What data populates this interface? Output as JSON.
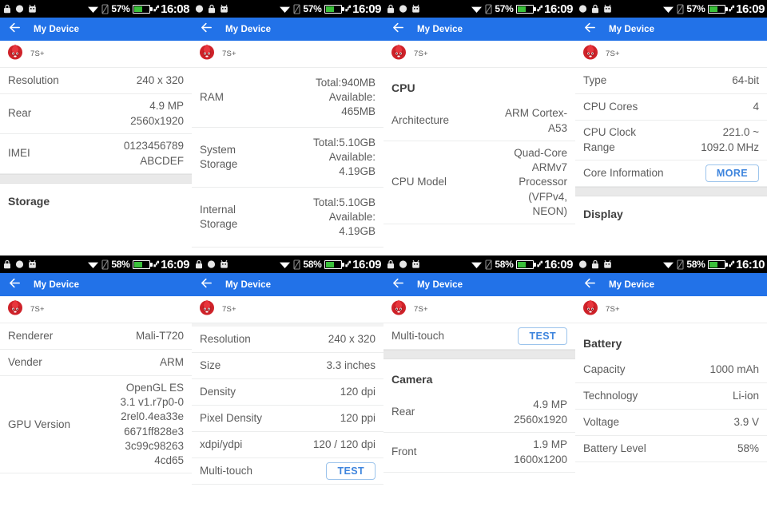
{
  "app": {
    "title": "My Device",
    "device_name": "7S+",
    "accent_color": "#2272e8",
    "logo_icon": "antutu-flame-logo",
    "back_icon": "back-arrow-icon"
  },
  "panels": [
    {
      "status": {
        "time": "16:08",
        "battery_percent": "57%",
        "left_icons": [
          "lock-icon",
          "circle-icon",
          "android-robot-icon"
        ],
        "right_icons": [
          "wifi-icon",
          "sim-card-off-icon",
          "battery-charging-icon"
        ]
      },
      "rows": [
        {
          "key": "Resolution",
          "value": "240 x 320",
          "size": "one"
        },
        {
          "key": "Rear",
          "value": "4.9 MP\n2560x1920",
          "size": "two"
        },
        {
          "key": "IMEI",
          "value": "0123456789\nABCDEF",
          "size": "two"
        }
      ],
      "band_after_rows": true,
      "section_footer": "Storage"
    },
    {
      "status": {
        "time": "16:09",
        "battery_percent": "57%",
        "left_icons": [
          "circle-icon",
          "lock-icon",
          "android-robot-icon"
        ],
        "right_icons": [
          "wifi-icon",
          "sim-card-off-icon",
          "battery-charging-icon"
        ]
      },
      "rows": [
        {
          "key": "RAM",
          "value": "Total:940MB\nAvailable:\n465MB",
          "size": "three"
        },
        {
          "key": "System\nStorage",
          "value": "Total:5.10GB\nAvailable:\n4.19GB",
          "size": "three"
        },
        {
          "key": "Internal\nStorage",
          "value": "Total:5.10GB\nAvailable:\n4.19GB",
          "size": "three"
        }
      ]
    },
    {
      "status": {
        "time": "16:09",
        "battery_percent": "57%",
        "left_icons": [
          "lock-icon",
          "circle-icon",
          "android-robot-icon"
        ],
        "right_icons": [
          "wifi-icon",
          "sim-card-off-icon",
          "battery-charging-icon"
        ]
      },
      "section_header": "CPU",
      "rows": [
        {
          "key": "Architecture",
          "value": "ARM Cortex-\nA53",
          "size": "two"
        },
        {
          "key": "CPU Model",
          "value": "Quad-Core\nARMv7\nProcessor\n(VFPv4,\nNEON)",
          "size": "five"
        }
      ]
    },
    {
      "status": {
        "time": "16:09",
        "battery_percent": "57%",
        "left_icons": [
          "circle-icon",
          "lock-icon",
          "android-robot-icon"
        ],
        "right_icons": [
          "wifi-icon",
          "sim-card-off-icon",
          "battery-charging-icon"
        ]
      },
      "rows": [
        {
          "key": "Type",
          "value": "64-bit",
          "size": "one"
        },
        {
          "key": "CPU Cores",
          "value": "4",
          "size": "one"
        },
        {
          "key": "CPU Clock\nRange",
          "value": "221.0 ~\n1092.0 MHz",
          "size": "two"
        },
        {
          "key": "Core Information",
          "button": "MORE",
          "size": "one"
        }
      ],
      "band_after_rows": true,
      "section_footer": "Display"
    },
    {
      "status": {
        "time": "16:09",
        "battery_percent": "58%",
        "left_icons": [
          "lock-icon",
          "circle-icon",
          "android-robot-icon"
        ],
        "right_icons": [
          "wifi-icon",
          "sim-card-off-icon",
          "battery-charging-icon"
        ]
      },
      "rows": [
        {
          "key": "Renderer",
          "value": "Mali-T720",
          "size": "one"
        },
        {
          "key": "Vender",
          "value": "ARM",
          "size": "one"
        },
        {
          "key": "GPU Version",
          "value": "OpenGL ES\n3.1 v1.r7p0-0\n2rel0.4ea33e\n6671ff828e3\n3c99c98263\n4cd65",
          "size": "six"
        }
      ]
    },
    {
      "status": {
        "time": "16:09",
        "battery_percent": "58%",
        "left_icons": [
          "lock-icon",
          "circle-icon",
          "android-robot-icon"
        ],
        "right_icons": [
          "wifi-icon",
          "sim-card-off-icon",
          "battery-charging-icon"
        ]
      },
      "top_gap": true,
      "rows": [
        {
          "key": "Resolution",
          "value": "240 x 320",
          "size": "one"
        },
        {
          "key": "Size",
          "value": "3.3 inches",
          "size": "one"
        },
        {
          "key": "Density",
          "value": "120 dpi",
          "size": "one"
        },
        {
          "key": "Pixel Density",
          "value": "120 ppi",
          "size": "one"
        },
        {
          "key": "xdpi/ydpi",
          "value": "120 / 120 dpi",
          "size": "one"
        },
        {
          "key": "Multi-touch",
          "button": "TEST",
          "size": "one",
          "clipped": true
        }
      ]
    },
    {
      "status": {
        "time": "16:09",
        "battery_percent": "58%",
        "left_icons": [
          "lock-icon",
          "circle-icon",
          "android-robot-icon"
        ],
        "right_icons": [
          "wifi-icon",
          "sim-card-off-icon",
          "battery-charging-icon"
        ]
      },
      "rows": [
        {
          "key": "Multi-touch",
          "button": "TEST",
          "size": "one"
        }
      ],
      "band_after_rows": true,
      "section_mid": "Camera",
      "rows2": [
        {
          "key": "Rear",
          "value": "4.9 MP\n2560x1920",
          "size": "two"
        },
        {
          "key": "Front",
          "value": "1.9 MP\n1600x1200",
          "size": "two"
        }
      ]
    },
    {
      "status": {
        "time": "16:10",
        "battery_percent": "58%",
        "left_icons": [
          "circle-icon",
          "lock-icon",
          "android-robot-icon"
        ],
        "right_icons": [
          "wifi-icon",
          "sim-card-off-icon",
          "battery-charging-icon"
        ]
      },
      "section_header": "Battery",
      "rows": [
        {
          "key": "Capacity",
          "value": "1000 mAh",
          "size": "one"
        },
        {
          "key": "Technology",
          "value": "Li-ion",
          "size": "one"
        },
        {
          "key": "Voltage",
          "value": "3.9 V",
          "size": "one"
        },
        {
          "key": "Battery Level",
          "value": "58%",
          "size": "one"
        }
      ]
    }
  ]
}
